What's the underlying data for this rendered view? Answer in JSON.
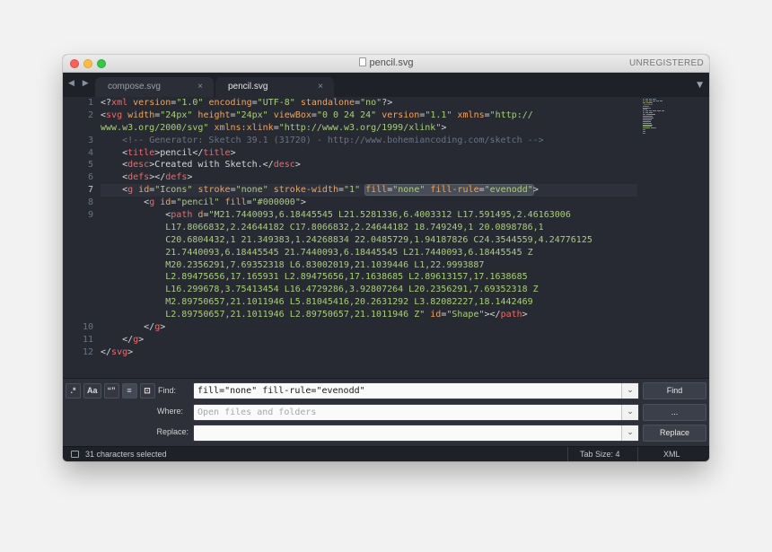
{
  "window": {
    "title": "pencil.svg",
    "license": "UNREGISTERED"
  },
  "tabs": [
    {
      "label": "compose.svg",
      "close": "×",
      "active": false
    },
    {
      "label": "pencil.svg",
      "close": "×",
      "active": true
    }
  ],
  "nav": {
    "arrows": "◀ ▶",
    "dropdown": "▼"
  },
  "code": {
    "current_line": "7",
    "lines": [
      {
        "n": "1",
        "tokens": [
          [
            "p",
            "<?"
          ],
          [
            "tag",
            "xml"
          ],
          [
            "p",
            " "
          ],
          [
            "attr",
            "version"
          ],
          [
            "p",
            "="
          ],
          [
            "str",
            "\"1.0\""
          ],
          [
            "p",
            " "
          ],
          [
            "attr",
            "encoding"
          ],
          [
            "p",
            "="
          ],
          [
            "str",
            "\"UTF-8\""
          ],
          [
            "p",
            " "
          ],
          [
            "attr",
            "standalone"
          ],
          [
            "p",
            "="
          ],
          [
            "str",
            "\"no\""
          ],
          [
            "p",
            "?>"
          ]
        ]
      },
      {
        "n": "2",
        "tokens": [
          [
            "p",
            "<"
          ],
          [
            "tag",
            "svg"
          ],
          [
            "p",
            " "
          ],
          [
            "attr",
            "width"
          ],
          [
            "p",
            "="
          ],
          [
            "str",
            "\"24px\""
          ],
          [
            "p",
            " "
          ],
          [
            "attr",
            "height"
          ],
          [
            "p",
            "="
          ],
          [
            "str",
            "\"24px\""
          ],
          [
            "p",
            " "
          ],
          [
            "attr",
            "viewBox"
          ],
          [
            "p",
            "="
          ],
          [
            "str",
            "\"0 0 24 24\""
          ],
          [
            "p",
            " "
          ],
          [
            "attr",
            "version"
          ],
          [
            "p",
            "="
          ],
          [
            "str",
            "\"1.1\""
          ],
          [
            "p",
            " "
          ],
          [
            "attr",
            "xmlns"
          ],
          [
            "p",
            "="
          ],
          [
            "str",
            "\"http://"
          ]
        ]
      },
      {
        "n": "",
        "tokens": [
          [
            "str",
            "www.w3.org/2000/svg\""
          ],
          [
            "p",
            " "
          ],
          [
            "attr",
            "xmlns:xlink"
          ],
          [
            "p",
            "="
          ],
          [
            "str",
            "\"http://www.w3.org/1999/xlink\""
          ],
          [
            "p",
            ">"
          ]
        ]
      },
      {
        "n": "3",
        "tokens": [
          [
            "p",
            "    "
          ],
          [
            "comment",
            "<!-- Generator: Sketch 39.1 (31720) - http://www.bohemiancoding.com/sketch -->"
          ]
        ]
      },
      {
        "n": "4",
        "tokens": [
          [
            "p",
            "    <"
          ],
          [
            "tag",
            "title"
          ],
          [
            "p",
            ">"
          ],
          [
            "text",
            "pencil"
          ],
          [
            "p",
            "</"
          ],
          [
            "tag",
            "title"
          ],
          [
            "p",
            ">"
          ]
        ]
      },
      {
        "n": "5",
        "tokens": [
          [
            "p",
            "    <"
          ],
          [
            "tag",
            "desc"
          ],
          [
            "p",
            ">"
          ],
          [
            "text",
            "Created with Sketch."
          ],
          [
            "p",
            "</"
          ],
          [
            "tag",
            "desc"
          ],
          [
            "p",
            ">"
          ]
        ]
      },
      {
        "n": "6",
        "tokens": [
          [
            "p",
            "    <"
          ],
          [
            "tag",
            "defs"
          ],
          [
            "p",
            "></"
          ],
          [
            "tag",
            "defs"
          ],
          [
            "p",
            ">"
          ]
        ]
      },
      {
        "n": "7",
        "tokens": [
          [
            "p",
            "    <"
          ],
          [
            "tag",
            "g"
          ],
          [
            "p",
            " "
          ],
          [
            "attr",
            "id"
          ],
          [
            "p",
            "="
          ],
          [
            "str",
            "\"Icons\""
          ],
          [
            "p",
            " "
          ],
          [
            "attr",
            "stroke"
          ],
          [
            "p",
            "="
          ],
          [
            "str",
            "\"none\""
          ],
          [
            "p",
            " "
          ],
          [
            "attr",
            "stroke-width"
          ],
          [
            "p",
            "="
          ],
          [
            "str",
            "\"1\""
          ],
          [
            "p",
            " "
          ],
          [
            "hl",
            ""
          ],
          [
            "p",
            ">"
          ]
        ],
        "highlight": [
          [
            "attr",
            "fill"
          ],
          [
            "p",
            "="
          ],
          [
            "str",
            "\"none\""
          ],
          [
            "p",
            " "
          ],
          [
            "attr",
            "fill-rule"
          ],
          [
            "p",
            "="
          ],
          [
            "str",
            "\"evenodd\""
          ]
        ]
      },
      {
        "n": "8",
        "tokens": [
          [
            "p",
            "        <"
          ],
          [
            "tag",
            "g"
          ],
          [
            "p",
            " "
          ],
          [
            "attr",
            "id"
          ],
          [
            "p",
            "="
          ],
          [
            "str",
            "\"pencil\""
          ],
          [
            "p",
            " "
          ],
          [
            "attr",
            "fill"
          ],
          [
            "p",
            "="
          ],
          [
            "str",
            "\"#000000\""
          ],
          [
            "p",
            ">"
          ]
        ]
      },
      {
        "n": "9",
        "tokens": [
          [
            "p",
            "            <"
          ],
          [
            "tag",
            "path"
          ],
          [
            "p",
            " "
          ],
          [
            "attr",
            "d"
          ],
          [
            "p",
            "="
          ],
          [
            "str",
            "\"M21.7440093,6.18445545 L21.5281336,6.4003312 L17.591495,2.46163006"
          ]
        ]
      },
      {
        "n": "",
        "tokens": [
          [
            "str",
            "            L17.8066832,2.24644182 C17.8066832,2.24644182 18.749249,1 20.0898786,1"
          ]
        ]
      },
      {
        "n": "",
        "tokens": [
          [
            "str",
            "            C20.6804432,1 21.349383,1.24268834 22.0485729,1.94187826 C24.3544559,4.24776125"
          ]
        ]
      },
      {
        "n": "",
        "tokens": [
          [
            "str",
            "            21.7440093,6.18445545 21.7440093,6.18445545 L21.7440093,6.18445545 Z"
          ]
        ]
      },
      {
        "n": "",
        "tokens": [
          [
            "str",
            "            M20.2356291,7.69352318 L6.83002019,21.1039446 L1,22.9993887"
          ]
        ]
      },
      {
        "n": "",
        "tokens": [
          [
            "str",
            "            L2.89475656,17.165931 L2.89475656,17.1638685 L2.89613157,17.1638685"
          ]
        ]
      },
      {
        "n": "",
        "tokens": [
          [
            "str",
            "            L16.299678,3.75413454 L16.4729286,3.92807264 L20.2356291,7.69352318 Z"
          ]
        ]
      },
      {
        "n": "",
        "tokens": [
          [
            "str",
            "            M2.89750657,21.1011946 L5.81045416,20.2631292 L3.82082227,18.1442469"
          ]
        ]
      },
      {
        "n": "",
        "tokens": [
          [
            "str",
            "            L2.89750657,21.1011946 L2.89750657,21.1011946 Z\""
          ],
          [
            "p",
            " "
          ],
          [
            "attr",
            "id"
          ],
          [
            "p",
            "="
          ],
          [
            "str",
            "\"Shape\""
          ],
          [
            "p",
            "></"
          ],
          [
            "tag",
            "path"
          ],
          [
            "p",
            ">"
          ]
        ]
      },
      {
        "n": "10",
        "tokens": [
          [
            "p",
            "        </"
          ],
          [
            "tag",
            "g"
          ],
          [
            "p",
            ">"
          ]
        ]
      },
      {
        "n": "11",
        "tokens": [
          [
            "p",
            "    </"
          ],
          [
            "tag",
            "g"
          ],
          [
            "p",
            ">"
          ]
        ]
      },
      {
        "n": "12",
        "tokens": [
          [
            "p",
            "</"
          ],
          [
            "tag",
            "svg"
          ],
          [
            "p",
            ">"
          ]
        ]
      }
    ]
  },
  "find_panel": {
    "options": [
      ".*",
      "Aa",
      "“”",
      "≡",
      "⊡"
    ],
    "find_label": "Find:",
    "find_value": "fill=\"none\" fill-rule=\"evenodd\"",
    "find_button": "Find",
    "where_label": "Where:",
    "where_placeholder": "Open files and folders",
    "where_button": "...",
    "replace_label": "Replace:",
    "replace_value": "",
    "replace_button": "Replace",
    "dropdown_glyph": "⌄"
  },
  "status": {
    "selection": "31 characters selected",
    "tab_size": "Tab Size: 4",
    "syntax": "XML"
  },
  "colors": {
    "background": "#272a33",
    "tag": "#ed6a6a",
    "attribute": "#f0a45a",
    "string": "#a9cf78",
    "comment": "#6c7180"
  }
}
